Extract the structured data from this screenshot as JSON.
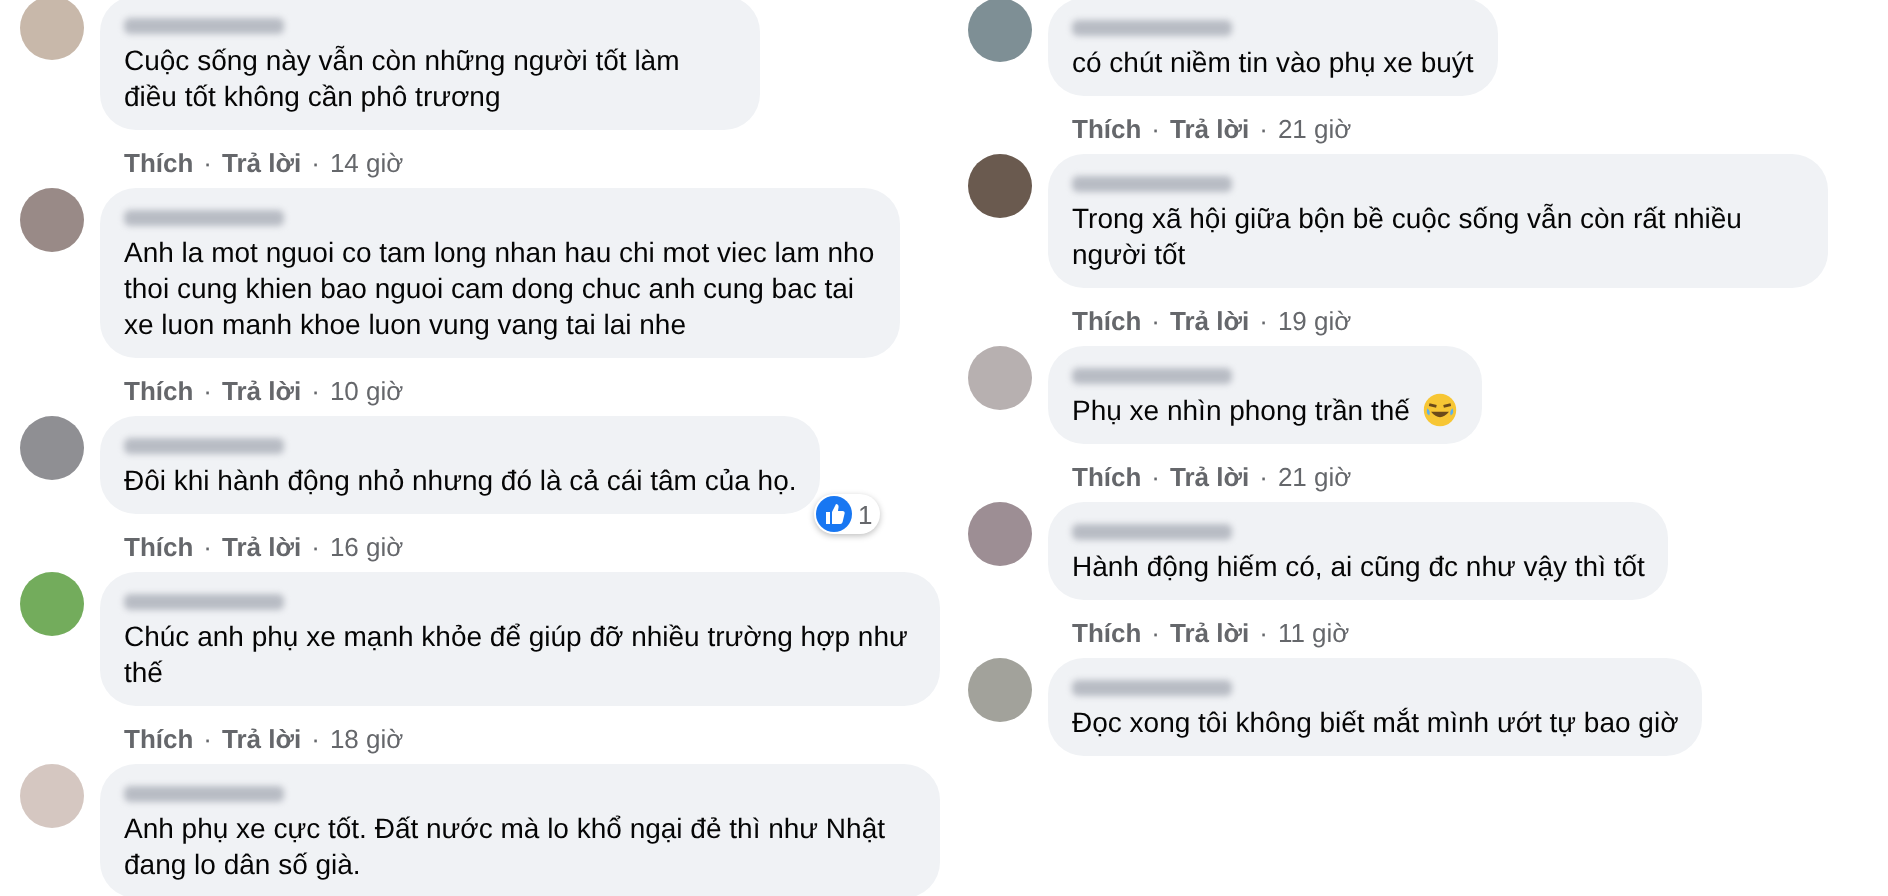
{
  "separator": "·",
  "columns": [
    {
      "comments": [
        {
          "text": "Cuộc sống này vẫn còn những người tốt làm điều tốt không cần phô trương",
          "actions": [
            "Thích",
            "Trả lời"
          ],
          "time": "14 giờ"
        },
        {
          "text": "Anh la mot nguoi co tam long nhan hau chi mot viec lam nho thoi cung khien bao nguoi cam dong chuc anh cung bac tai xe luon manh khoe luon vung vang tai lai nhe",
          "actions": [
            "Thích",
            "Trả lời"
          ],
          "time": "10 giờ"
        },
        {
          "text": "Đôi khi hành động nhỏ nhưng đó là cả cái tâm của họ.",
          "actions": [
            "Thích",
            "Trả lời"
          ],
          "time": "16 giờ",
          "reaction_count": "1"
        },
        {
          "text": "Chúc anh phụ xe mạnh khỏe để giúp đỡ nhiều trường hợp như thế",
          "actions": [
            "Thích",
            "Trả lời"
          ],
          "time": "18 giờ"
        },
        {
          "text": "Anh phụ xe cực tốt. Đất nước mà lo khổ ngại đẻ thì như Nhật đang lo dân số già."
        }
      ]
    },
    {
      "comments": [
        {
          "text": "có chút niềm tin vào phụ xe buýt",
          "actions": [
            "Thích",
            "Trả lời"
          ],
          "time": "21 giờ"
        },
        {
          "text": "Trong xã hội giữa bộn bề cuộc sống vẫn còn rất nhiều người tốt",
          "actions": [
            "Thích",
            "Trả lời"
          ],
          "time": "19 giờ"
        },
        {
          "text": "Phụ xe nhìn phong trần thế",
          "kind": "with-emoji",
          "actions": [
            "Thích",
            "Trả lời"
          ],
          "time": "21 giờ"
        },
        {
          "text": "Hành động hiếm có, ai cũng đc như vậy thì tốt",
          "actions": [
            "Thích",
            "Trả lời"
          ],
          "time": "11 giờ"
        },
        {
          "text": "Đọc xong tôi không biết mắt mình ướt tự bao giờ"
        }
      ]
    }
  ]
}
